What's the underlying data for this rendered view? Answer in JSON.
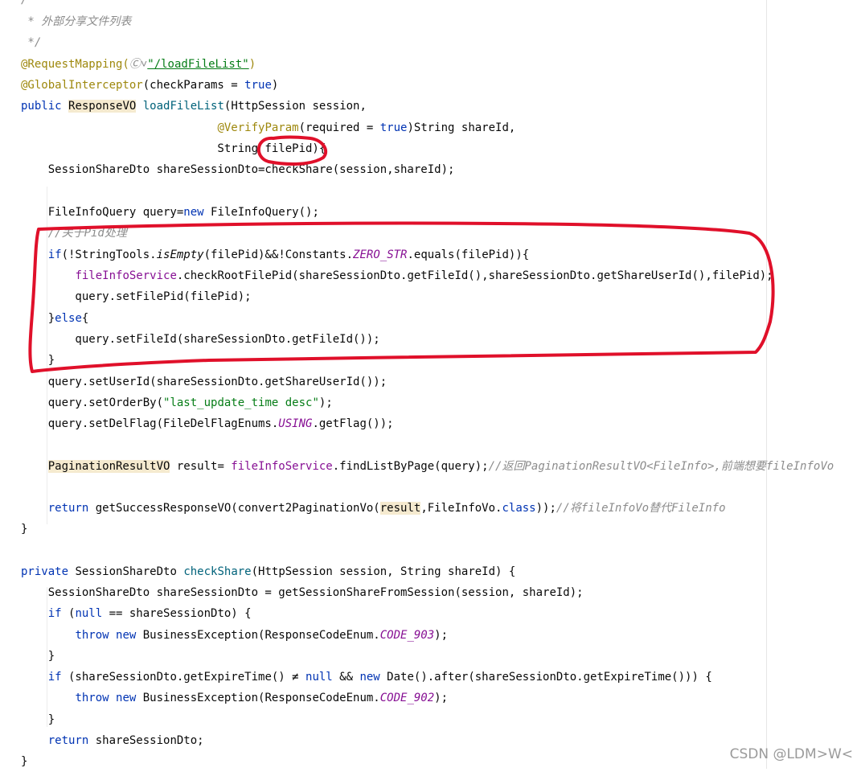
{
  "code": {
    "l01": "/**",
    "l02": " * 外部分享文件列表",
    "l03": " */",
    "l04": [
      [
        "ann",
        "@RequestMapping("
      ],
      [
        "c",
        "Ⓒ˅"
      ],
      [
        "s link",
        "\"/loadFileList\""
      ],
      [
        "ann",
        ")"
      ]
    ],
    "l05": [
      [
        "ann",
        "@GlobalInterceptor"
      ],
      [
        "",
        "(checkParams = "
      ],
      [
        "k",
        "true"
      ],
      [
        "",
        ")"
      ]
    ],
    "l06": [
      [
        "k",
        "public "
      ],
      [
        "hl",
        "ResponseVO"
      ],
      [
        "",
        " "
      ],
      [
        "m",
        "loadFileList"
      ],
      [
        "",
        "(HttpSession session,"
      ]
    ],
    "l07": [
      [
        "",
        "                             "
      ],
      [
        "ann",
        "@VerifyParam"
      ],
      [
        "",
        "(required = "
      ],
      [
        "k",
        "true"
      ],
      [
        "",
        ")String shareId,"
      ]
    ],
    "l08": [
      [
        "",
        "                             String filePid){"
      ]
    ],
    "l09": [
      [
        "",
        "    SessionShareDto shareSessionDto=checkShare(session,shareId);"
      ]
    ],
    "l10": [
      [
        "",
        ""
      ]
    ],
    "l11": [
      [
        "",
        "    FileInfoQuery query="
      ],
      [
        "k",
        "new"
      ],
      [
        "",
        " FileInfoQuery();"
      ]
    ],
    "l12": [
      [
        "",
        "    "
      ],
      [
        "c",
        "//关于Pid处理"
      ]
    ],
    "l13": [
      [
        "",
        "    "
      ],
      [
        "k",
        "if"
      ],
      [
        "",
        "(!StringTools."
      ],
      [
        "st",
        "isEmpty"
      ],
      [
        "",
        "(filePid)&&!Constants."
      ],
      [
        "cst",
        "ZERO_STR"
      ],
      [
        "",
        ".equals(filePid)){"
      ]
    ],
    "l14": [
      [
        "",
        "        "
      ],
      [
        "f",
        "fileInfoService"
      ],
      [
        "",
        ".checkRootFilePid(shareSessionDto.getFileId(),shareSessionDto.getShareUserId(),filePid);"
      ]
    ],
    "l15": [
      [
        "",
        "        query.setFilePid(filePid);"
      ]
    ],
    "l16": [
      [
        "",
        "    }"
      ],
      [
        "k",
        "else"
      ],
      [
        "",
        "{"
      ]
    ],
    "l17": [
      [
        "",
        "        query.setFileId(shareSessionDto.getFileId());"
      ]
    ],
    "l18": [
      [
        "",
        "    }"
      ]
    ],
    "l19": [
      [
        "",
        "    query.setUserId(shareSessionDto.getShareUserId());"
      ]
    ],
    "l20": [
      [
        "",
        "    query.setOrderBy("
      ],
      [
        "s",
        "\"last_update_time desc\""
      ],
      [
        "",
        ");"
      ]
    ],
    "l21": [
      [
        "",
        "    query.setDelFlag(FileDelFlagEnums."
      ],
      [
        "cst",
        "USING"
      ],
      [
        "",
        ".getFlag());"
      ]
    ],
    "l22": [
      [
        "",
        ""
      ]
    ],
    "l23": [
      [
        "",
        "    "
      ],
      [
        "hl",
        "PaginationResultVO"
      ],
      [
        "",
        " result= "
      ],
      [
        "f",
        "fileInfoService"
      ],
      [
        "",
        ".findListByPage(query);"
      ],
      [
        "c",
        "//返回PaginationResultVO<FileInfo>,前端想要fileInfoVo"
      ]
    ],
    "l24": [
      [
        "",
        ""
      ]
    ],
    "l25": [
      [
        "",
        "    "
      ],
      [
        "k",
        "return"
      ],
      [
        "",
        " getSuccessResponseVO(convert2PaginationVo("
      ],
      [
        "hl",
        "result"
      ],
      [
        "",
        ",FileInfoVo."
      ],
      [
        "k",
        "class"
      ],
      [
        "",
        "));"
      ],
      [
        "c",
        "//将fileInfoVo替代FileInfo"
      ]
    ],
    "l26": [
      [
        "",
        "}"
      ]
    ],
    "l27": [
      [
        "",
        ""
      ]
    ],
    "l28": [
      [
        "k",
        "private"
      ],
      [
        "",
        " SessionShareDto "
      ],
      [
        "m",
        "checkShare"
      ],
      [
        "",
        "(HttpSession session, String shareId) {"
      ]
    ],
    "l29": [
      [
        "",
        "    SessionShareDto shareSessionDto = getSessionShareFromSession(session, shareId);"
      ]
    ],
    "l30": [
      [
        "",
        "    "
      ],
      [
        "k",
        "if"
      ],
      [
        "",
        " ("
      ],
      [
        "k",
        "null"
      ],
      [
        "",
        " == shareSessionDto) {"
      ]
    ],
    "l31": [
      [
        "",
        "        "
      ],
      [
        "k",
        "throw new"
      ],
      [
        "",
        " BusinessException(ResponseCodeEnum."
      ],
      [
        "cst",
        "CODE_903"
      ],
      [
        "",
        ");"
      ]
    ],
    "l32": [
      [
        "",
        "    }"
      ]
    ],
    "l33": [
      [
        "",
        "    "
      ],
      [
        "k",
        "if"
      ],
      [
        "",
        " (shareSessionDto.getExpireTime() ≠ "
      ],
      [
        "k",
        "null"
      ],
      [
        "",
        " && "
      ],
      [
        "k",
        "new"
      ],
      [
        "",
        " Date().after(shareSessionDto.getExpireTime())) {"
      ]
    ],
    "l34": [
      [
        "",
        "        "
      ],
      [
        "k",
        "throw new"
      ],
      [
        "",
        " BusinessException(ResponseCodeEnum."
      ],
      [
        "cst",
        "CODE_902"
      ],
      [
        "",
        ");"
      ]
    ],
    "l35": [
      [
        "",
        "    }"
      ]
    ],
    "l36": [
      [
        "",
        "    "
      ],
      [
        "k",
        "return"
      ],
      [
        "",
        " shareSessionDto;"
      ]
    ],
    "l37": [
      [
        "",
        "}"
      ]
    ]
  },
  "watermark": "CSDN @LDM>W<",
  "colors": {
    "keyword": "#0033b3",
    "annotation": "#9e880d",
    "string": "#067d17",
    "comment": "#8c8c8c",
    "field": "#871094",
    "method": "#00627a",
    "highlight": "#f5eacf",
    "markup": "#e0102a"
  }
}
